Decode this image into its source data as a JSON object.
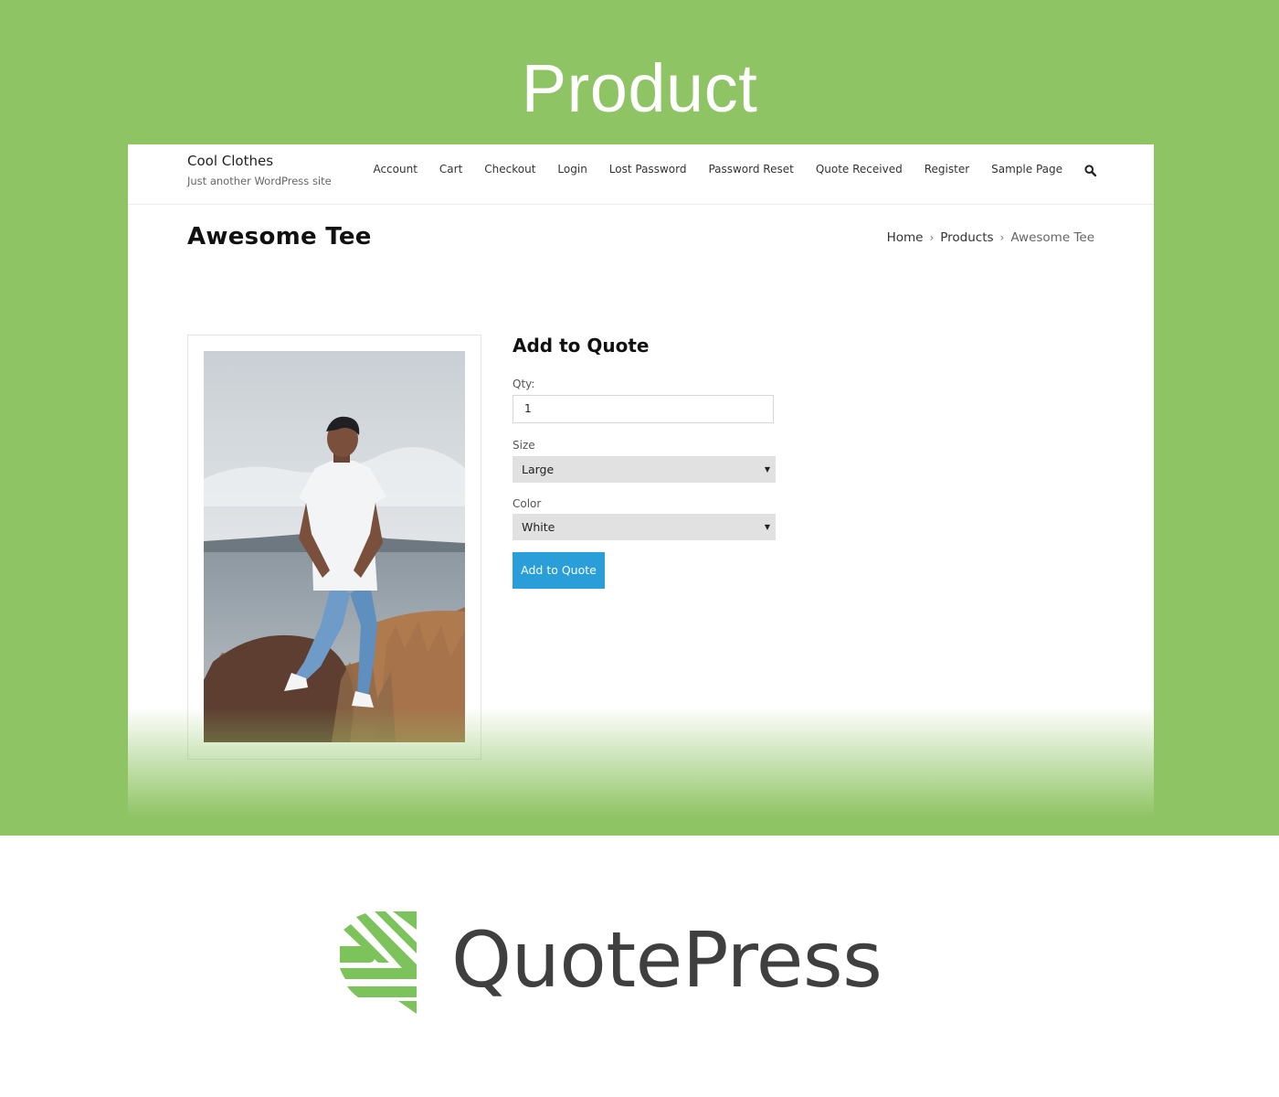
{
  "banner": {
    "title": "Product",
    "color": "#8fc464"
  },
  "site": {
    "title": "Cool Clothes",
    "tagline": "Just another WordPress site",
    "nav": [
      "Account",
      "Cart",
      "Checkout",
      "Login",
      "Lost Password",
      "Password Reset",
      "Quote Received",
      "Register",
      "Sample Page"
    ],
    "search_icon": "search-icon"
  },
  "page": {
    "title": "Awesome Tee",
    "breadcrumb": [
      "Home",
      "Products",
      "Awesome Tee"
    ]
  },
  "product": {
    "image_icon": "product-photo",
    "form": {
      "title": "Add to Quote",
      "qty_label": "Qty:",
      "qty_value": "1",
      "size_label": "Size",
      "size_value": "Large",
      "color_label": "Color",
      "color_value": "White",
      "button_label": "Add to Quote",
      "button_color": "#2a9ed9"
    }
  },
  "brand": {
    "name": "QuotePress",
    "accent": "#7cc35b"
  }
}
